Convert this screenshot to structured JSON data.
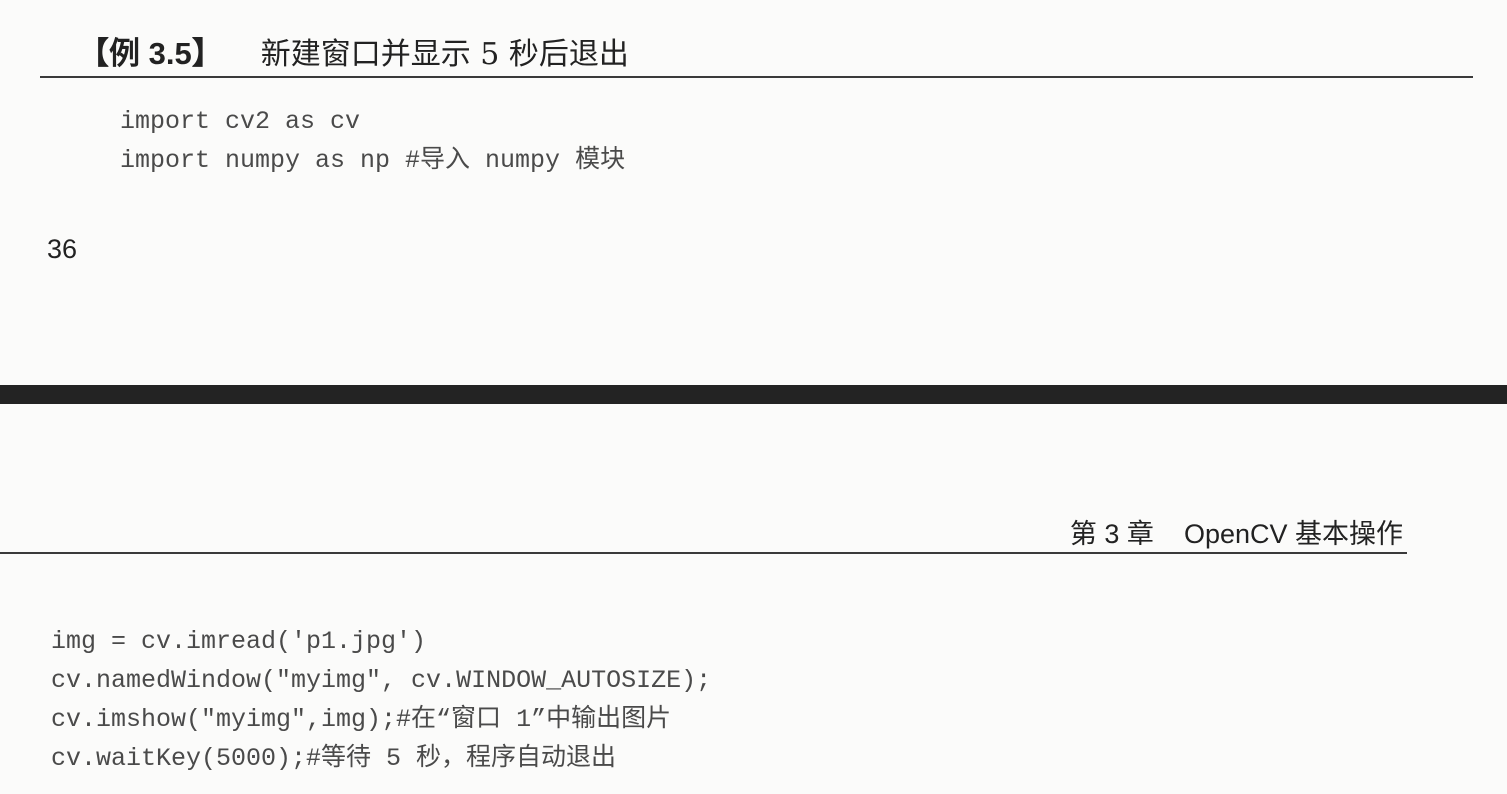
{
  "top_page": {
    "example_label": "【例 3.5】",
    "example_title": "新建窗口并显示 5 秒后退出",
    "code_lines": [
      "import cv2 as cv",
      "import numpy as np #导入 numpy 模块"
    ],
    "page_number": "36"
  },
  "bottom_page": {
    "header": {
      "chapter": "第 3 章",
      "title": "OpenCV 基本操作"
    },
    "code_lines": [
      "img = cv.imread('p1.jpg')",
      "cv.namedWindow(\"myimg\", cv.WINDOW_AUTOSIZE);",
      "cv.imshow(\"myimg\",img);#在“窗口 1”中输出图片",
      "cv.waitKey(5000);#等待 5 秒，程序自动退出"
    ]
  },
  "colors": {
    "paper": "#fbfbfa",
    "divider": "#232323",
    "code_text": "#4a4a4a",
    "heading_text": "#222222"
  }
}
